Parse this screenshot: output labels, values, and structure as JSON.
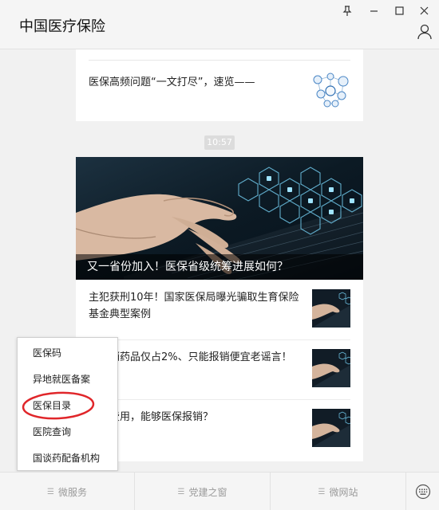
{
  "window": {
    "title": "中国医疗保险",
    "pin_icon": "pin-icon",
    "minimize_icon": "minimize-icon",
    "maximize_icon": "maximize-icon",
    "close_icon": "close-icon",
    "profile_icon": "profile-icon"
  },
  "feed": {
    "article_top": {
      "text": "医保高频问题“一文打尽”，速览——"
    },
    "timestamp": "10:57",
    "hero_caption": "又一省份加入！医保省级统筹进展如何？",
    "items": [
      {
        "text": "主犯获刑10年！国家医保局曝光骗取生育保险基金典型案例"
      },
      {
        "text": "打报销药品仅占2%、只能报销便宜老谣言！"
      },
      {
        "text": "医疗费用，能够医保报销？"
      }
    ]
  },
  "popup_menu": {
    "items": [
      {
        "label": "医保码"
      },
      {
        "label": "异地就医备案"
      },
      {
        "label": "医保目录"
      },
      {
        "label": "医院查询"
      },
      {
        "label": "国谈药配备机构"
      }
    ],
    "highlight_color": "#e0262a"
  },
  "bottom_bar": {
    "tabs": [
      {
        "label": "微服务"
      },
      {
        "label": "党建之窗"
      },
      {
        "label": "微网站"
      }
    ],
    "keyboard_icon": "keyboard-icon"
  }
}
